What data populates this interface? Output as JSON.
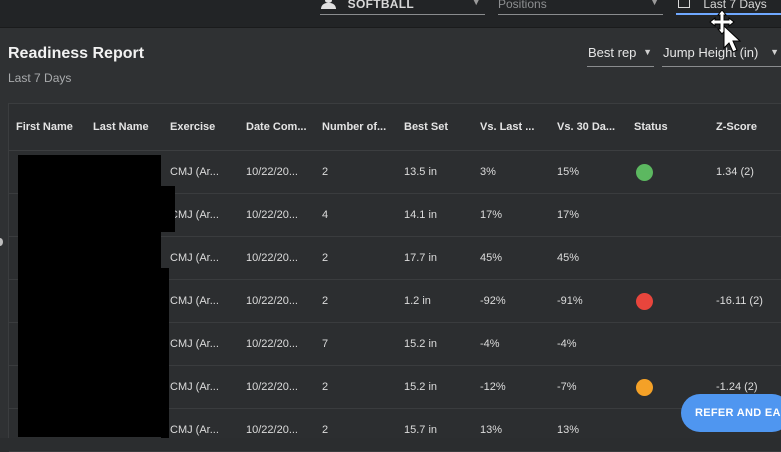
{
  "topbar": {
    "sport": "SOFTBALL",
    "positions_placeholder": "Positions",
    "date_range": "Last 7 Days"
  },
  "report": {
    "title": "Readiness Report",
    "subtitle": "Last 7 Days",
    "metric_select": "Best rep",
    "unit_select": "Jump Height (in)"
  },
  "table": {
    "headers": [
      "First Name",
      "Last Name",
      "Exercise",
      "Date Com...",
      "Number of...",
      "Best Set",
      "Vs. Last ...",
      "Vs. 30 Da...",
      "Status",
      "Z-Score"
    ],
    "rows": [
      {
        "exercise": "CMJ (Ar...",
        "date": "10/22/20...",
        "number": "2",
        "best_set": "13.5 in",
        "vs_last": "3%",
        "vs_30": "15%",
        "status_color": "#5cb860",
        "z_score": "1.34 (2)"
      },
      {
        "exercise": "CMJ (Ar...",
        "date": "10/22/20...",
        "number": "4",
        "best_set": "14.1 in",
        "vs_last": "17%",
        "vs_30": "17%",
        "status_color": "",
        "z_score": ""
      },
      {
        "exercise": "CMJ (Ar...",
        "date": "10/22/20...",
        "number": "2",
        "best_set": "17.7 in",
        "vs_last": "45%",
        "vs_30": "45%",
        "status_color": "",
        "z_score": ""
      },
      {
        "exercise": "CMJ (Ar...",
        "date": "10/22/20...",
        "number": "2",
        "best_set": "1.2 in",
        "vs_last": "-92%",
        "vs_30": "-91%",
        "status_color": "#e8453c",
        "z_score": "-16.11 (2)"
      },
      {
        "exercise": "CMJ (Ar...",
        "date": "10/22/20...",
        "number": "7",
        "best_set": "15.2 in",
        "vs_last": "-4%",
        "vs_30": "-4%",
        "status_color": "",
        "z_score": ""
      },
      {
        "exercise": "CMJ (Ar...",
        "date": "10/22/20...",
        "number": "2",
        "best_set": "15.2 in",
        "vs_last": "-12%",
        "vs_30": "-7%",
        "status_color": "#f4a127",
        "z_score": "-1.24 (2)"
      },
      {
        "exercise": "CMJ (Ar...",
        "date": "10/22/20...",
        "number": "2",
        "best_set": "15.7 in",
        "vs_last": "13%",
        "vs_30": "13%",
        "status_color": "",
        "z_score": ""
      }
    ]
  },
  "fab": {
    "label": "REFER AND EARN"
  },
  "colors": {
    "accent": "#4f96f0",
    "status_green": "#5cb860",
    "status_red": "#e8453c",
    "status_orange": "#f4a127"
  },
  "icons": {
    "sport": "person-group-icon",
    "date_range": "calendar-icon",
    "cursor": "move-cursor-icon"
  }
}
